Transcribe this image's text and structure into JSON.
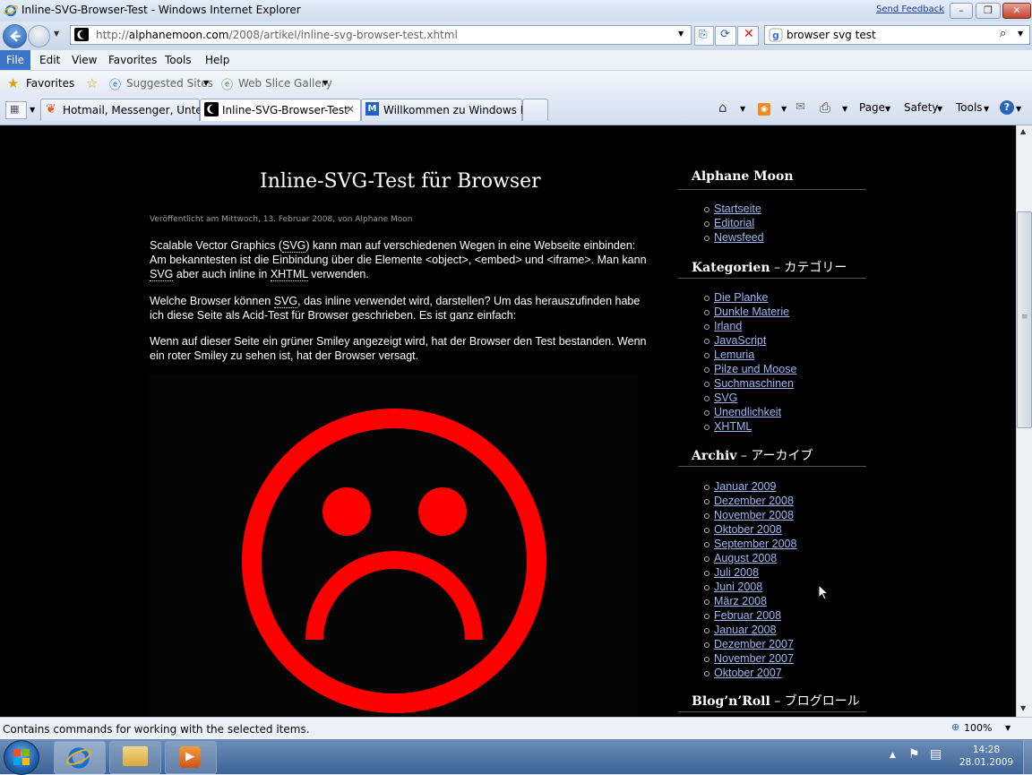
{
  "window": {
    "title": "Inline-SVG-Browser-Test - Windows Internet Explorer",
    "send_feedback": "Send Feedback"
  },
  "address": {
    "url_prefix": "http://",
    "url_domain": "alphanemoon.com",
    "url_path": "/2008/artikel/inline-svg-browser-test.xhtml"
  },
  "search": {
    "value": "browser svg test"
  },
  "menu": {
    "items": [
      "File",
      "Edit",
      "View",
      "Favorites",
      "Tools",
      "Help"
    ]
  },
  "favorites_bar": {
    "favorites": "Favorites",
    "suggested_sites": "Suggested Sites",
    "web_slice_gallery": "Web Slice Gallery"
  },
  "tabs": [
    {
      "label": "Hotmail, Messenger, Unter..."
    },
    {
      "label": "Inline-SVG-Browser-Test"
    },
    {
      "label": "Willkommen zu Windows I..."
    }
  ],
  "command_bar": {
    "page": "Page",
    "safety": "Safety",
    "tools": "Tools"
  },
  "article": {
    "title": "Inline-SVG-Test für Browser",
    "byline": "Veröffentlicht am Mittwoch, 13. Februar 2008, von Alphane Moon",
    "p1": {
      "a": "Scalable Vector Graphics (",
      "b": "SVG",
      "c": ") kann man auf verschiedenen Wegen in eine Webseite einbinden: Am bekanntesten ist die Einbindung über die Elemente <object>, <embed> und <iframe>. Man kann ",
      "d": "SVG",
      "e": " aber auch inline in ",
      "f": "XHTML",
      "g": " verwenden."
    },
    "p2": {
      "a": "Welche Browser können ",
      "b": "SVG",
      "c": ", das inline verwendet wird, darstellen? Um das herauszufinden habe ich diese Seite als Acid-Test für Browser geschrieben. Es ist ganz einfach:"
    },
    "p3": "Wenn auf dieser Seite ein grüner Smiley angezeigt wird, hat der Browser den Test bestanden. Wenn ein roter Smiley zu sehen ist, hat der Browser versagt."
  },
  "sidebar": {
    "site": {
      "title": "Alphane Moon",
      "items": [
        "Startseite",
        "Editorial",
        "Newsfeed"
      ]
    },
    "categories": {
      "title": "Kategorien",
      "title_jp": " – カテゴリー",
      "items": [
        "Die Planke",
        "Dunkle Materie",
        "Irland",
        "JavaScript",
        "Lemuria",
        "Pilze und Moose",
        "Suchmaschinen",
        "SVG",
        "Unendlichkeit",
        "XHTML"
      ]
    },
    "archive": {
      "title": "Archiv",
      "title_jp": " – アーカイブ",
      "items": [
        "Januar 2009",
        "Dezember 2008",
        "November 2008",
        "Oktober 2008",
        "September 2008",
        "August 2008",
        "Juli 2008",
        "Juni 2008",
        "März 2008",
        "Februar 2008",
        "Januar 2008",
        "Dezember 2007",
        "November 2007",
        "Oktober 2007"
      ]
    },
    "blogroll": {
      "title": "Blog’n’Roll",
      "title_jp": " – ブログロール"
    }
  },
  "smiley": {
    "color": "#ff0000"
  },
  "status": {
    "text": "Contains commands for working with the selected items.",
    "zoom": "100%"
  },
  "taskbar": {
    "time": "14:28",
    "date": "28.01.2009"
  }
}
